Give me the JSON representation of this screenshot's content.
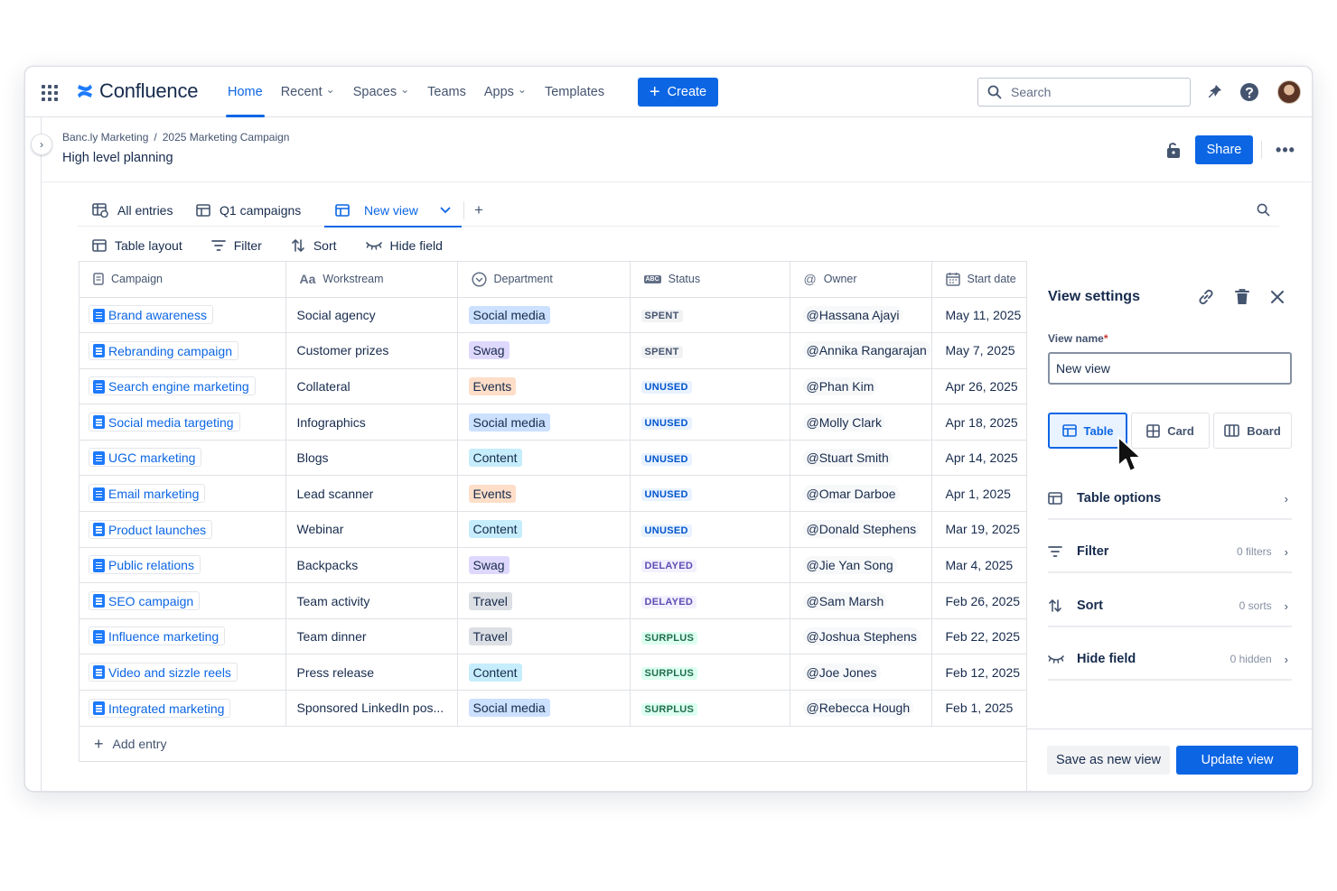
{
  "nav": {
    "logo": "Confluence",
    "items": [
      {
        "label": "Home",
        "active": true,
        "dropdown": false
      },
      {
        "label": "Recent",
        "active": false,
        "dropdown": true
      },
      {
        "label": "Spaces",
        "active": false,
        "dropdown": true
      },
      {
        "label": "Teams",
        "active": false,
        "dropdown": false
      },
      {
        "label": "Apps",
        "active": false,
        "dropdown": true
      },
      {
        "label": "Templates",
        "active": false,
        "dropdown": false
      }
    ],
    "create_label": "Create",
    "search_placeholder": "Search"
  },
  "page": {
    "breadcrumb": [
      "Banc.ly Marketing",
      "2025 Marketing Campaign"
    ],
    "title": "High level planning",
    "share_label": "Share"
  },
  "view_tabs": [
    {
      "label": "All entries",
      "icon": "all-entries-icon",
      "active": false
    },
    {
      "label": "Q1 campaigns",
      "icon": "table-icon",
      "active": false
    },
    {
      "label": "New view",
      "icon": "table-icon",
      "active": true
    }
  ],
  "toolbar": {
    "layout": "Table layout",
    "filter": "Filter",
    "sort": "Sort",
    "hide": "Hide field"
  },
  "table": {
    "columns": [
      "Campaign",
      "Workstream",
      "Department",
      "Status",
      "Owner",
      "Start date"
    ],
    "rows": [
      {
        "campaign": "Brand awareness",
        "workstream": "Social agency",
        "department": "Social media",
        "status": "SPENT",
        "owner": "Hassana Ajayi",
        "date": "May 11, 2025"
      },
      {
        "campaign": "Rebranding campaign",
        "workstream": "Customer prizes",
        "department": "Swag",
        "status": "SPENT",
        "owner": "Annika Rangarajan",
        "date": "May 7, 2025"
      },
      {
        "campaign": "Search engine marketing",
        "workstream": "Collateral",
        "department": "Events",
        "status": "UNUSED",
        "owner": "Phan Kim",
        "date": "Apr 26, 2025"
      },
      {
        "campaign": "Social media targeting",
        "workstream": "Infographics",
        "department": "Social media",
        "status": "UNUSED",
        "owner": "Molly Clark",
        "date": "Apr 18, 2025"
      },
      {
        "campaign": "UGC marketing",
        "workstream": "Blogs",
        "department": "Content",
        "status": "UNUSED",
        "owner": "Stuart Smith",
        "date": "Apr 14, 2025"
      },
      {
        "campaign": "Email marketing",
        "workstream": "Lead scanner",
        "department": "Events",
        "status": "UNUSED",
        "owner": "Omar Darboe",
        "date": "Apr 1, 2025"
      },
      {
        "campaign": "Product launches",
        "workstream": "Webinar",
        "department": "Content",
        "status": "UNUSED",
        "owner": "Donald Stephens",
        "date": "Mar 19, 2025"
      },
      {
        "campaign": "Public relations",
        "workstream": "Backpacks",
        "department": "Swag",
        "status": "DELAYED",
        "owner": "Jie Yan Song",
        "date": "Mar 4, 2025"
      },
      {
        "campaign": "SEO campaign",
        "workstream": "Team activity",
        "department": "Travel",
        "status": "DELAYED",
        "owner": "Sam Marsh",
        "date": "Feb 26, 2025"
      },
      {
        "campaign": "Influence marketing",
        "workstream": "Team dinner",
        "department": "Travel",
        "status": "SURPLUS",
        "owner": "Joshua Stephens",
        "date": "Feb 22, 2025"
      },
      {
        "campaign": "Video and sizzle reels",
        "workstream": "Press release",
        "department": "Content",
        "status": "SURPLUS",
        "owner": "Joe Jones",
        "date": "Feb 12, 2025"
      },
      {
        "campaign": "Integrated marketing",
        "workstream": "Sponsored LinkedIn pos...",
        "department": "Social media",
        "status": "SURPLUS",
        "owner": "Rebecca Hough",
        "date": "Feb 1, 2025"
      }
    ],
    "add_entry": "Add entry"
  },
  "colors": {
    "accent": "#0c66e4",
    "departments": {
      "Social media": "#cce0ff",
      "Swag": "#dfd8fd",
      "Events": "#fedec8",
      "Content": "#c6edfb",
      "Travel": "#dcdfe4"
    },
    "status": {
      "SPENT": {
        "bg": "#f1f2f4",
        "fg": "#44546f"
      },
      "UNUSED": {
        "bg": "#e9f2ff",
        "fg": "#0055cc"
      },
      "DELAYED": {
        "bg": "#f3f0ff",
        "fg": "#5e4db2"
      },
      "SURPLUS": {
        "bg": "#dcfff1",
        "fg": "#216e4e"
      }
    }
  },
  "settings": {
    "title": "View settings",
    "view_name_label": "View name",
    "view_name_required": "*",
    "view_name_value": "New view",
    "layouts": [
      {
        "label": "Table",
        "selected": true
      },
      {
        "label": "Card",
        "selected": false
      },
      {
        "label": "Board",
        "selected": false
      }
    ],
    "rows": [
      {
        "label": "Table options",
        "count": ""
      },
      {
        "label": "Filter",
        "count": "0 filters"
      },
      {
        "label": "Sort",
        "count": "0 sorts"
      },
      {
        "label": "Hide field",
        "count": "0 hidden"
      }
    ],
    "save_new": "Save as new view",
    "update": "Update view"
  }
}
